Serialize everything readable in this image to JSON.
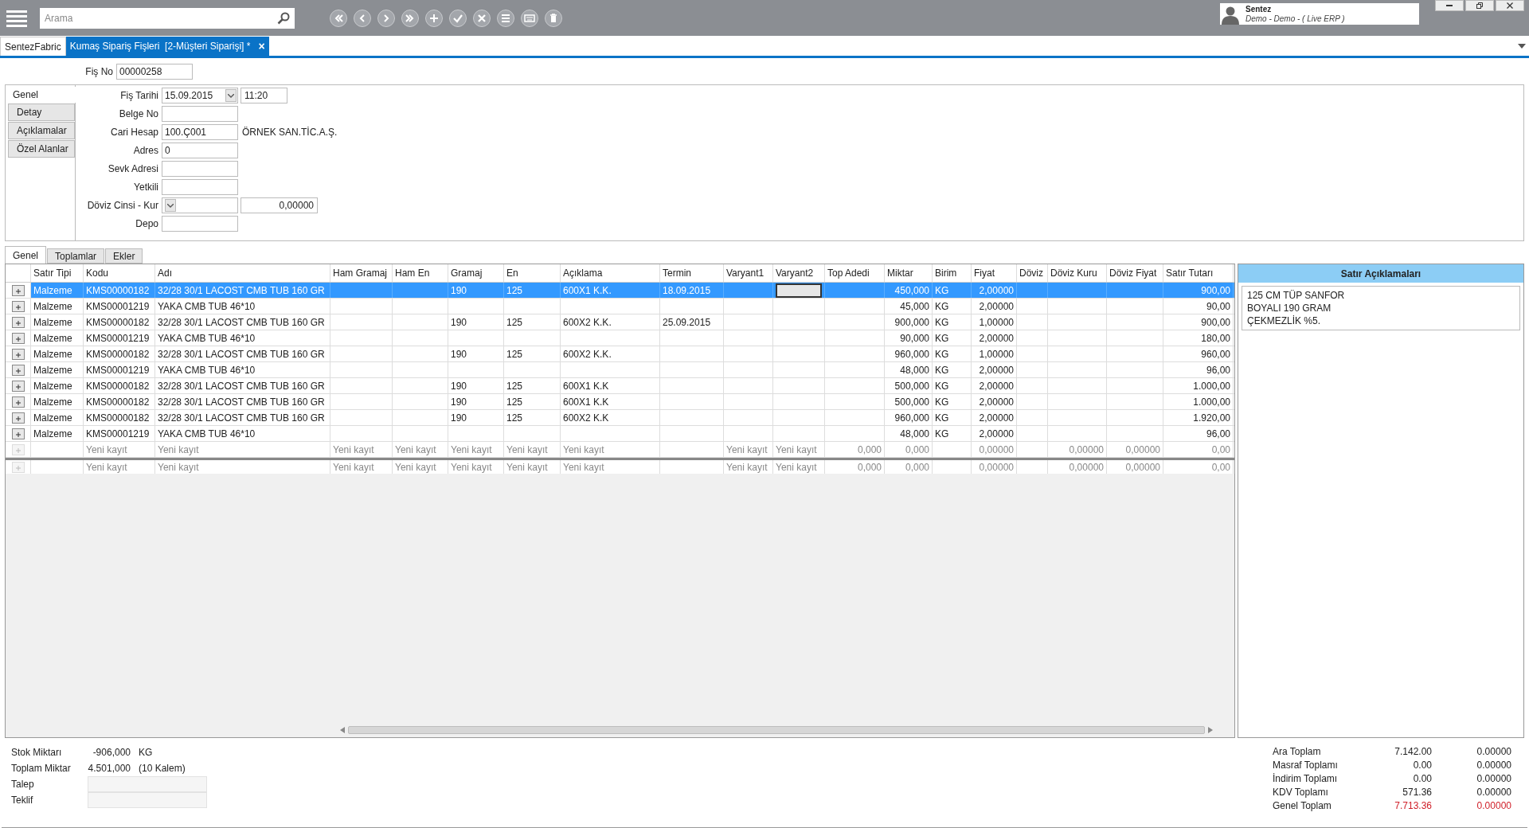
{
  "search": {
    "placeholder": "Arama"
  },
  "toolbar": [
    {
      "kind": "first"
    },
    {
      "kind": "prev"
    },
    {
      "kind": "next"
    },
    {
      "kind": "last"
    },
    {
      "kind": "add"
    },
    {
      "kind": "check"
    },
    {
      "kind": "cancel"
    },
    {
      "kind": "list"
    },
    {
      "kind": "keyboard"
    },
    {
      "kind": "trash"
    }
  ],
  "user": {
    "name": "Sentez",
    "detail": "Demo - Demo - ( Live ERP )"
  },
  "doc_tabs": [
    {
      "label": "SentezFabric",
      "selected": false,
      "closable": false
    },
    {
      "label": "Kumaş Sipariş Fişleri  [2-Müşteri Siparişi] *",
      "selected": true,
      "closable": true,
      "close": "×"
    }
  ],
  "fis_no": {
    "label": "Fiş No",
    "value": "00000258"
  },
  "form_tabs": [
    {
      "label": "Genel",
      "selected": true
    },
    {
      "label": "Detay",
      "selected": false
    },
    {
      "label": "Açıklamalar",
      "selected": false
    },
    {
      "label": "Özel Alanlar",
      "selected": false
    }
  ],
  "fields": [
    {
      "label": "Fiş Tarihi",
      "kind": "combo",
      "value": "15.09.2015",
      "extra": "11:20"
    },
    {
      "label": "Belge No",
      "kind": "text"
    },
    {
      "label": "Cari Hesap",
      "kind": "text",
      "value": "100.Ç001",
      "note": "ÖRNEK SAN.TİC.A.Ş."
    },
    {
      "label": "Adres",
      "kind": "text",
      "value": "0"
    },
    {
      "label": "Sevk Adresi",
      "kind": "text"
    },
    {
      "label": "Yetkili",
      "kind": "text"
    },
    {
      "label": "Döviz Cinsi - Kur",
      "kind": "combo",
      "extra": "0,00000"
    },
    {
      "label": "Depo",
      "kind": "text"
    }
  ],
  "grid_tabs": [
    {
      "label": "Genel",
      "selected": true
    },
    {
      "label": "Toplamlar",
      "selected": false
    },
    {
      "label": "Ekler",
      "selected": false
    }
  ],
  "table": {
    "columns": [
      {
        "label": "Satır Tipi",
        "kind": "text",
        "focused": false
      },
      {
        "label": "Kodu",
        "kind": "text",
        "focused": false
      },
      {
        "label": "Adı",
        "kind": "text",
        "focused": false
      },
      {
        "label": "Ham Gramaj",
        "kind": "text",
        "focused": false
      },
      {
        "label": "Ham En",
        "kind": "text",
        "focused": false
      },
      {
        "label": "Gramaj",
        "kind": "text",
        "focused": false
      },
      {
        "label": "En",
        "kind": "text",
        "focused": false
      },
      {
        "label": "Açıklama",
        "kind": "text",
        "focused": false
      },
      {
        "label": "Termin",
        "kind": "text",
        "focused": false
      },
      {
        "label": "Varyant1",
        "kind": "text",
        "focused": false
      },
      {
        "label": "Varyant2",
        "kind": "text",
        "focused": true
      },
      {
        "label": "Top Adedi",
        "kind": "number",
        "focused": false
      },
      {
        "label": "Miktar",
        "kind": "number",
        "focused": false
      },
      {
        "label": "Birim",
        "kind": "text",
        "focused": false
      },
      {
        "label": "Fiyat",
        "kind": "number",
        "focused": false
      },
      {
        "label": "Döviz",
        "kind": "text",
        "focused": false
      },
      {
        "label": "Döviz Kuru",
        "kind": "number",
        "focused": false
      },
      {
        "label": "Döviz Fiyat",
        "kind": "number",
        "focused": false
      },
      {
        "label": "Satır Tutarı",
        "kind": "number",
        "focused": false
      }
    ],
    "rows": [
      {
        "kind": "data",
        "selected": true,
        "cells": [
          "Malzeme",
          "KMS00000182",
          "32/28 30/1 LACOST CMB TUB 160 GR",
          "",
          "",
          "190",
          "125",
          "600X1 K.K.",
          "18.09.2015",
          "",
          "",
          "",
          "450,000",
          "KG",
          "2,00000",
          "",
          "",
          "",
          "900,00"
        ]
      },
      {
        "kind": "data",
        "selected": false,
        "cells": [
          "Malzeme",
          "KMS00001219",
          "YAKA CMB TUB 46*10",
          "",
          "",
          "",
          "",
          "",
          "",
          "",
          "",
          "",
          "45,000",
          "KG",
          "2,00000",
          "",
          "",
          "",
          "90,00"
        ]
      },
      {
        "kind": "data",
        "selected": false,
        "cells": [
          "Malzeme",
          "KMS00000182",
          "32/28 30/1 LACOST CMB TUB 160 GR",
          "",
          "",
          "190",
          "125",
          "600X2 K.K.",
          "25.09.2015",
          "",
          "",
          "",
          "900,000",
          "KG",
          "1,00000",
          "",
          "",
          "",
          "900,00"
        ]
      },
      {
        "kind": "data",
        "selected": false,
        "cells": [
          "Malzeme",
          "KMS00001219",
          "YAKA CMB TUB 46*10",
          "",
          "",
          "",
          "",
          "",
          "",
          "",
          "",
          "",
          "90,000",
          "KG",
          "2,00000",
          "",
          "",
          "",
          "180,00"
        ]
      },
      {
        "kind": "data",
        "selected": false,
        "cells": [
          "Malzeme",
          "KMS00000182",
          "32/28 30/1 LACOST CMB TUB 160 GR",
          "",
          "",
          "190",
          "125",
          "600X2 K.K.",
          "",
          "",
          "",
          "",
          "960,000",
          "KG",
          "1,00000",
          "",
          "",
          "",
          "960,00"
        ]
      },
      {
        "kind": "data",
        "selected": false,
        "cells": [
          "Malzeme",
          "KMS00001219",
          "YAKA CMB TUB 46*10",
          "",
          "",
          "",
          "",
          "",
          "",
          "",
          "",
          "",
          "48,000",
          "KG",
          "2,00000",
          "",
          "",
          "",
          "96,00"
        ]
      },
      {
        "kind": "data",
        "selected": false,
        "cells": [
          "Malzeme",
          "KMS00000182",
          "32/28 30/1 LACOST CMB TUB 160 GR",
          "",
          "",
          "190",
          "125",
          "600X1 K.K",
          "",
          "",
          "",
          "",
          "500,000",
          "KG",
          "2,00000",
          "",
          "",
          "",
          "1.000,00"
        ]
      },
      {
        "kind": "data",
        "selected": false,
        "cells": [
          "Malzeme",
          "KMS00000182",
          "32/28 30/1 LACOST CMB TUB 160 GR",
          "",
          "",
          "190",
          "125",
          "600X1 K.K",
          "",
          "",
          "",
          "",
          "500,000",
          "KG",
          "2,00000",
          "",
          "",
          "",
          "1.000,00"
        ]
      },
      {
        "kind": "data",
        "selected": false,
        "cells": [
          "Malzeme",
          "KMS00000182",
          "32/28 30/1 LACOST CMB TUB 160 GR",
          "",
          "",
          "190",
          "125",
          "600X2 K.K",
          "",
          "",
          "",
          "",
          "960,000",
          "KG",
          "2,00000",
          "",
          "",
          "",
          "1.920,00"
        ]
      },
      {
        "kind": "data",
        "selected": false,
        "cells": [
          "Malzeme",
          "KMS00001219",
          "YAKA CMB TUB 46*10",
          "",
          "",
          "",
          "",
          "",
          "",
          "",
          "",
          "",
          "48,000",
          "KG",
          "2,00000",
          "",
          "",
          "",
          "96,00"
        ]
      },
      {
        "kind": "new",
        "selected": false,
        "cells": [
          "",
          "Yeni kayıt",
          "Yeni kayıt",
          "Yeni kayıt",
          "Yeni kayıt",
          "Yeni kayıt",
          "Yeni kayıt",
          "Yeni kayıt",
          "",
          "Yeni kayıt",
          "Yeni kayıt",
          "0,000",
          "0,000",
          "",
          "0,00000",
          "",
          "0,00000",
          "0,00000",
          "0,00"
        ]
      },
      {
        "kind": "new",
        "selected": false,
        "cells": [
          "",
          "Yeni kayıt",
          "Yeni kayıt",
          "Yeni kayıt",
          "Yeni kayıt",
          "Yeni kayıt",
          "Yeni kayıt",
          "Yeni kayıt",
          "",
          "Yeni kayıt",
          "Yeni kayıt",
          "0,000",
          "0,000",
          "",
          "0,00000",
          "",
          "0,00000",
          "0,00000",
          "0,00"
        ]
      }
    ]
  },
  "line_notes": {
    "title": "Satır Açıklamaları",
    "text": "125 CM TÜP SANFOR\nBOYALI 190 GRAM\nÇEKMEZLİK %5."
  },
  "summary": [
    {
      "label": "Stok Miktarı",
      "kind": "value",
      "value": "-906,000",
      "unit": "KG"
    },
    {
      "label": "Toplam Miktar",
      "kind": "value",
      "value": "4.501,000",
      "unit": "(10 Kalem)"
    },
    {
      "label": "Talep",
      "kind": "field"
    },
    {
      "label": "Teklif",
      "kind": "field"
    }
  ],
  "totals": [
    {
      "label": "Ara Toplam",
      "value": "7.142.00",
      "currency": "0.00000",
      "highlight": false
    },
    {
      "label": "Masraf Toplamı",
      "value": "0.00",
      "currency": "0.00000",
      "highlight": false
    },
    {
      "label": "İndirim Toplamı",
      "value": "0.00",
      "currency": "0.00000",
      "highlight": false
    },
    {
      "label": "KDV Toplamı",
      "value": "571.36",
      "currency": "0.00000",
      "highlight": false
    },
    {
      "label": "Genel Toplam",
      "value": "7.713.36",
      "currency": "0.00000",
      "highlight": true
    }
  ]
}
